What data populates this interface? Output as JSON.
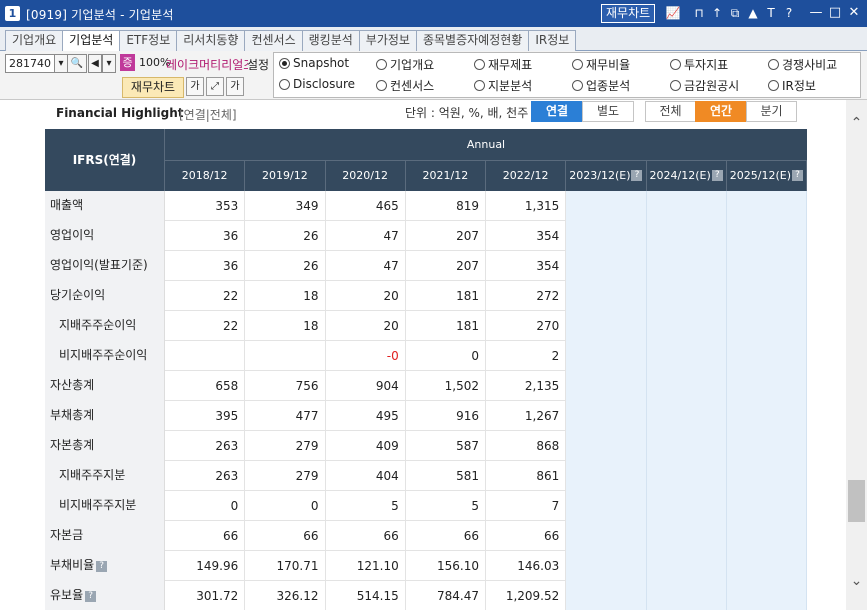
{
  "window": {
    "badge": "1",
    "title": "[0919] 기업분석 - 기업분석",
    "chart_button": "재무차트",
    "toolbar_icons": [
      "📈",
      "⊓",
      "↑",
      "⧉",
      "▲",
      "T",
      "?"
    ],
    "controls": {
      "minimize": "—",
      "restore": "□",
      "close": "✕"
    }
  },
  "tabs": [
    {
      "label": "기업개요",
      "active": false
    },
    {
      "label": "기업분석",
      "active": true
    },
    {
      "label": "ETF정보",
      "active": false
    },
    {
      "label": "리서치동향",
      "active": false
    },
    {
      "label": "컨센서스",
      "active": false
    },
    {
      "label": "랭킹분석",
      "active": false
    },
    {
      "label": "부가정보",
      "active": false
    },
    {
      "label": "종목별증자예정현황",
      "active": false
    },
    {
      "label": "IR정보",
      "active": false
    }
  ],
  "options": {
    "stock_code": "281740",
    "zeung_badge": "증",
    "percent": "100%",
    "company_name": "레이크머티리얼즈",
    "setting_label": "설정",
    "fin_chart_button": "재무차트",
    "font_btn": "가",
    "font_btn2": "가"
  },
  "radios": [
    {
      "label": "Snapshot",
      "selected": true
    },
    {
      "label": "기업개요",
      "selected": false
    },
    {
      "label": "재무제표",
      "selected": false
    },
    {
      "label": "재무비율",
      "selected": false
    },
    {
      "label": "투자지표",
      "selected": false
    },
    {
      "label": "경쟁사비교",
      "selected": false
    },
    {
      "label": "Disclosure",
      "selected": false
    },
    {
      "label": "컨센서스",
      "selected": false
    },
    {
      "label": "지분분석",
      "selected": false
    },
    {
      "label": "업종분석",
      "selected": false
    },
    {
      "label": "금감원공시",
      "selected": false
    },
    {
      "label": "IR정보",
      "selected": false
    }
  ],
  "highlight": {
    "title": "Financial Highlight",
    "subtitle": "[연결|전체]",
    "unit": "단위 : 억원, %, 배, 천주",
    "seg_consolidated": "연결",
    "seg_separate": "별도",
    "seg_all": "전체",
    "seg_annual": "연간",
    "seg_quarter": "분기"
  },
  "table": {
    "ifrs_header": "IFRS(연결)",
    "annual_header": "Annual",
    "years": [
      "2018/12",
      "2019/12",
      "2020/12",
      "2021/12",
      "2022/12",
      "2023/12(E)",
      "2024/12(E)",
      "2025/12(E)"
    ],
    "rows": [
      {
        "label": "매출액",
        "indent": false,
        "help": false,
        "values": [
          "353",
          "349",
          "465",
          "819",
          "1,315",
          "",
          "",
          ""
        ]
      },
      {
        "label": "영업이익",
        "indent": false,
        "help": false,
        "values": [
          "36",
          "26",
          "47",
          "207",
          "354",
          "",
          "",
          ""
        ]
      },
      {
        "label": "영업이익(발표기준)",
        "indent": false,
        "help": false,
        "values": [
          "36",
          "26",
          "47",
          "207",
          "354",
          "",
          "",
          ""
        ]
      },
      {
        "label": "당기순이익",
        "indent": false,
        "help": false,
        "values": [
          "22",
          "18",
          "20",
          "181",
          "272",
          "",
          "",
          ""
        ]
      },
      {
        "label": "지배주주순이익",
        "indent": true,
        "help": false,
        "values": [
          "22",
          "18",
          "20",
          "181",
          "270",
          "",
          "",
          ""
        ]
      },
      {
        "label": "비지배주주순이익",
        "indent": true,
        "help": false,
        "values": [
          "",
          "",
          "-0",
          "0",
          "2",
          "",
          "",
          ""
        ]
      },
      {
        "label": "자산총계",
        "indent": false,
        "help": false,
        "values": [
          "658",
          "756",
          "904",
          "1,502",
          "2,135",
          "",
          "",
          ""
        ]
      },
      {
        "label": "부채총계",
        "indent": false,
        "help": false,
        "values": [
          "395",
          "477",
          "495",
          "916",
          "1,267",
          "",
          "",
          ""
        ]
      },
      {
        "label": "자본총계",
        "indent": false,
        "help": false,
        "values": [
          "263",
          "279",
          "409",
          "587",
          "868",
          "",
          "",
          ""
        ]
      },
      {
        "label": "지배주주지분",
        "indent": true,
        "help": false,
        "values": [
          "263",
          "279",
          "404",
          "581",
          "861",
          "",
          "",
          ""
        ]
      },
      {
        "label": "비지배주주지분",
        "indent": true,
        "help": false,
        "values": [
          "0",
          "0",
          "5",
          "5",
          "7",
          "",
          "",
          ""
        ]
      },
      {
        "label": "자본금",
        "indent": false,
        "help": false,
        "values": [
          "66",
          "66",
          "66",
          "66",
          "66",
          "",
          "",
          ""
        ]
      },
      {
        "label": "부채비율",
        "indent": false,
        "help": true,
        "values": [
          "149.96",
          "170.71",
          "121.10",
          "156.10",
          "146.03",
          "",
          "",
          ""
        ]
      },
      {
        "label": "유보율",
        "indent": false,
        "help": true,
        "values": [
          "301.72",
          "326.12",
          "514.15",
          "784.47",
          "1,209.52",
          "",
          "",
          ""
        ]
      }
    ]
  },
  "help_glyph": "?",
  "scroll": {
    "up": "⌃",
    "down": "⌄"
  },
  "colors": {
    "titlebar": "#1e4f9c",
    "header": "#34495e",
    "estimate_bg": "#e8f2fb",
    "negative": "#e02020",
    "accent_blue": "#2b7fd6",
    "accent_orange": "#f08a24"
  }
}
